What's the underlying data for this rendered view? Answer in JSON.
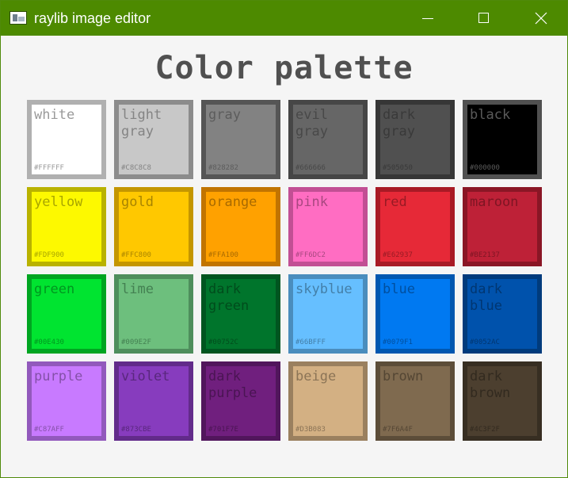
{
  "window": {
    "title": "raylib image editor"
  },
  "heading": "Color palette",
  "colors": [
    {
      "name": "white",
      "hex": "#FFFFFF",
      "fill": "#FFFFFF",
      "border": "#B0B0B0",
      "text": "#787878"
    },
    {
      "name": "light gray",
      "hex": "#C8C8C8",
      "fill": "#C8C8C8",
      "border": "#8C8C8C",
      "text": "#6E6E6E"
    },
    {
      "name": "gray",
      "hex": "#828282",
      "fill": "#828282",
      "border": "#555555",
      "text": "#505050"
    },
    {
      "name": "evil gray",
      "hex": "#666666",
      "fill": "#666666",
      "border": "#464646",
      "text": "#3E3E3E"
    },
    {
      "name": "dark gray",
      "hex": "#505050",
      "fill": "#505050",
      "border": "#363636",
      "text": "#323232"
    },
    {
      "name": "black",
      "hex": "#000000",
      "fill": "#000000",
      "border": "#505050",
      "text": "#787878"
    },
    {
      "name": "yellow",
      "hex": "#FDF900",
      "fill": "#FDF900",
      "border": "#B9B200",
      "text": "#8C8A00"
    },
    {
      "name": "gold",
      "hex": "#FFC800",
      "fill": "#FFC800",
      "border": "#C49600",
      "text": "#8C6E00"
    },
    {
      "name": "orange",
      "hex": "#FFA100",
      "fill": "#FFA100",
      "border": "#C17400",
      "text": "#8C5800"
    },
    {
      "name": "pink",
      "hex": "#FF6DC2",
      "fill": "#FF6DC2",
      "border": "#C24F94",
      "text": "#8C3B6A"
    },
    {
      "name": "red",
      "hex": "#E62937",
      "fill": "#E62937",
      "border": "#A81A25",
      "text": "#7E161E"
    },
    {
      "name": "maroon",
      "hex": "#BE2137",
      "fill": "#BE2137",
      "border": "#8A1625",
      "text": "#68111D"
    },
    {
      "name": "green",
      "hex": "#00E430",
      "fill": "#00E430",
      "border": "#00A521",
      "text": "#007D1A"
    },
    {
      "name": "lime",
      "hex": "#009E2F",
      "fill": "#6DBF7D",
      "border": "#4E8E5C",
      "text": "#356B43"
    },
    {
      "name": "dark green",
      "hex": "#00752C",
      "fill": "#00752C",
      "border": "#005520",
      "text": "#003F17"
    },
    {
      "name": "skyblue",
      "hex": "#66BFFF",
      "fill": "#66BFFF",
      "border": "#4A8DBD",
      "text": "#386A8C"
    },
    {
      "name": "blue",
      "hex": "#0079F1",
      "fill": "#0079F1",
      "border": "#0057B0",
      "text": "#004284"
    },
    {
      "name": "dark blue",
      "hex": "#0052AC",
      "fill": "#0052AC",
      "border": "#003B7C",
      "text": "#002D5E"
    },
    {
      "name": "purple",
      "hex": "#C87AFF",
      "fill": "#C87AFF",
      "border": "#9259BC",
      "text": "#6E438C"
    },
    {
      "name": "violet",
      "hex": "#873CBE",
      "fill": "#873CBE",
      "border": "#622B8A",
      "text": "#4A2168"
    },
    {
      "name": "dark purple",
      "hex": "#701F7E",
      "fill": "#701F7E",
      "border": "#51165C",
      "text": "#3E1145"
    },
    {
      "name": "beige",
      "hex": "#D3B083",
      "fill": "#D3B083",
      "border": "#9A805F",
      "text": "#746048"
    },
    {
      "name": "brown",
      "hex": "#7F6A4F",
      "fill": "#7F6A4F",
      "border": "#5C4D39",
      "text": "#463A2B"
    },
    {
      "name": "dark brown",
      "hex": "#4C3F2F",
      "fill": "#4C3F2F",
      "border": "#372E22",
      "text": "#2A231A"
    }
  ]
}
